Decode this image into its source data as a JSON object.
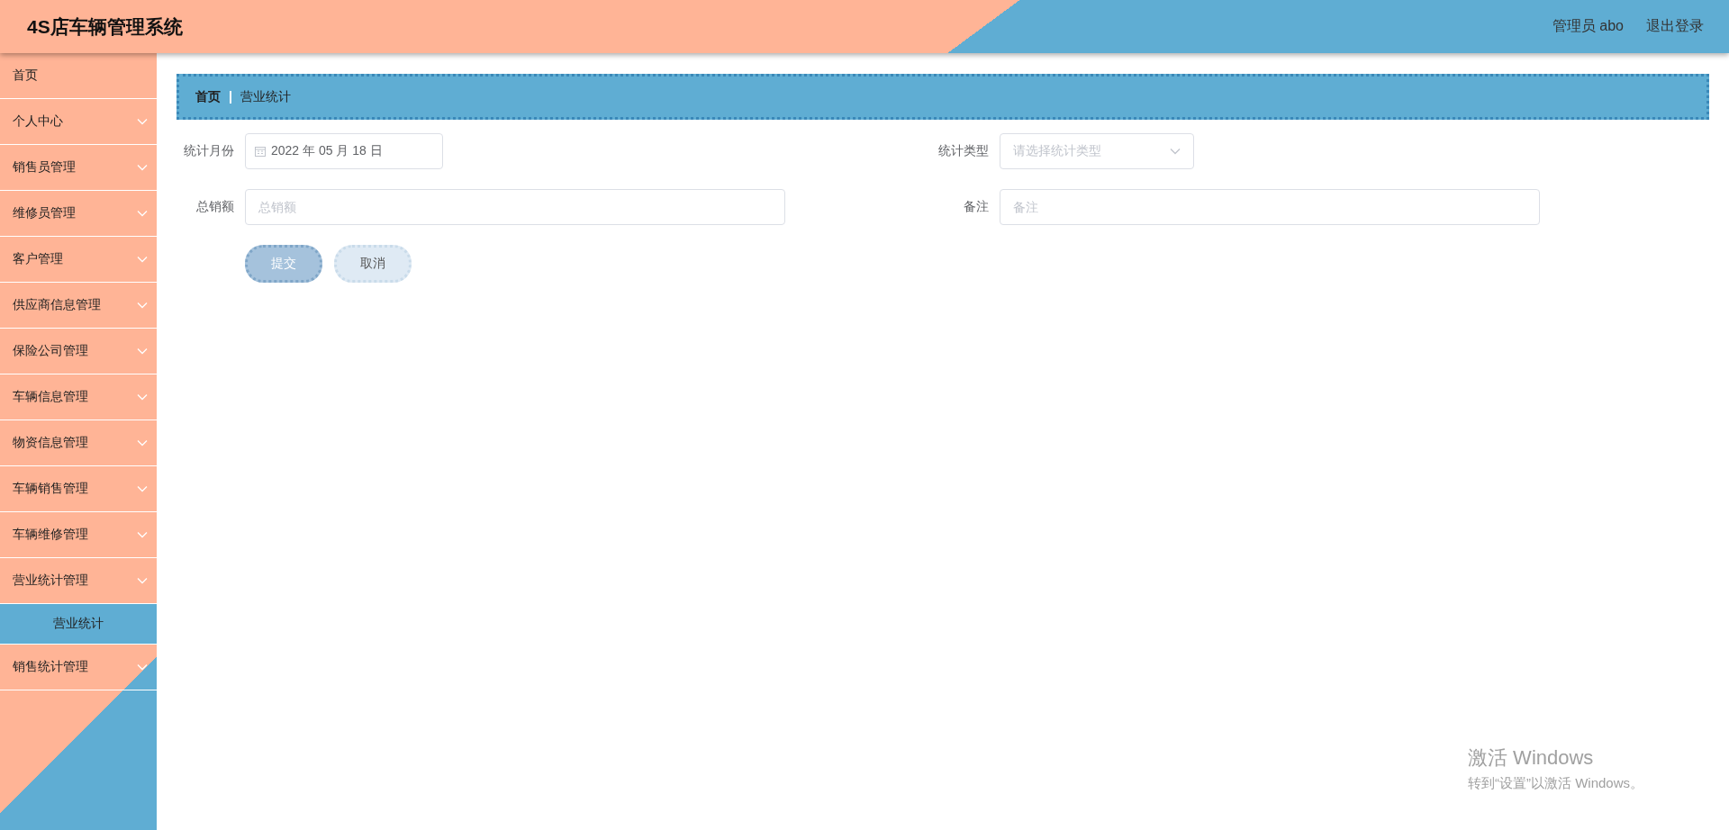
{
  "header": {
    "title": "4S店车辆管理系统",
    "user": "管理员 abo",
    "logout": "退出登录"
  },
  "sidebar": {
    "items": [
      {
        "label": "首页",
        "kind": "link"
      },
      {
        "label": "个人中心",
        "kind": "submenu"
      },
      {
        "label": "销售员管理",
        "kind": "submenu"
      },
      {
        "label": "维修员管理",
        "kind": "submenu"
      },
      {
        "label": "客户管理",
        "kind": "submenu"
      },
      {
        "label": "供应商信息管理",
        "kind": "submenu"
      },
      {
        "label": "保险公司管理",
        "kind": "submenu"
      },
      {
        "label": "车辆信息管理",
        "kind": "submenu"
      },
      {
        "label": "物资信息管理",
        "kind": "submenu"
      },
      {
        "label": "车辆销售管理",
        "kind": "submenu"
      },
      {
        "label": "车辆维修管理",
        "kind": "submenu"
      },
      {
        "label": "营业统计管理",
        "kind": "submenu",
        "children": [
          {
            "label": "营业统计",
            "selected": true
          }
        ]
      },
      {
        "label": "销售统计管理",
        "kind": "submenu"
      }
    ]
  },
  "breadcrumb": [
    "首页",
    "营业统计"
  ],
  "form": {
    "rows": [
      [
        {
          "label": "统计月份",
          "kind": "date",
          "value": "2022 年 05 月 18 日"
        },
        {
          "label": "统计类型",
          "kind": "select",
          "placeholder": "请选择统计类型"
        }
      ],
      [
        {
          "label": "总销额",
          "kind": "text",
          "placeholder": "总销额"
        },
        {
          "label": "备注",
          "kind": "text",
          "placeholder": "备注"
        }
      ]
    ],
    "buttons": [
      {
        "label": "提交",
        "kind": "primary"
      },
      {
        "label": "取消",
        "kind": "secondary"
      }
    ]
  },
  "activation_notice": {
    "title": "激活 Windows",
    "subtitle": "转到“设置”以激活 Windows。"
  }
}
